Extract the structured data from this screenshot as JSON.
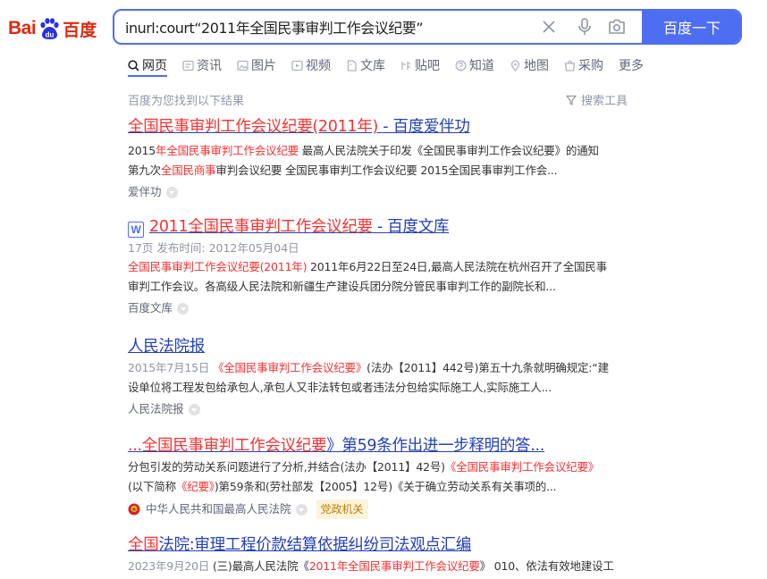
{
  "logo": {
    "latin": "Bai",
    "paw_text": "du",
    "chinese": "百度"
  },
  "search": {
    "query": "inurl:court“2011年全国民事审判工作会议纪要”",
    "button_label": "百度一下"
  },
  "tabs": [
    {
      "label": "网页",
      "icon": "search-icon",
      "active": true
    },
    {
      "label": "资讯",
      "icon": "news-icon"
    },
    {
      "label": "图片",
      "icon": "image-icon"
    },
    {
      "label": "视频",
      "icon": "video-icon"
    },
    {
      "label": "文库",
      "icon": "document-icon"
    },
    {
      "label": "贴吧",
      "icon": "tieba-icon"
    },
    {
      "label": "知道",
      "icon": "question-icon"
    },
    {
      "label": "地图",
      "icon": "map-icon"
    },
    {
      "label": "采购",
      "icon": "shopping-icon"
    },
    {
      "label": "更多"
    }
  ],
  "result_count": "百度为您找到以下结果",
  "tools_label": "搜索工具",
  "results": [
    {
      "title": {
        "a": "全国民事审判工作会议纪要(2011年)",
        "b": " - 百度爱伴功"
      },
      "abstract1": {
        "a": "2015",
        "b": "年全国民事审判工作会议纪要",
        "c": " 最高人民法院关于印发《全国民事审判工作会议纪要》的通知"
      },
      "abstract2": {
        "a": "第九次",
        "b": "全国民商事",
        "c": "审判会议纪要 全国民事审判工作会议纪要 2015全国民事审判工作会..."
      },
      "source": "爱伴功"
    },
    {
      "badge": "W",
      "title": {
        "a": "2011全国民事审判工作会议纪要",
        "b": " - 百度文库"
      },
      "meta": "17页 发布时间: 2012年05月04日",
      "abstract1": {
        "a": "全国民事审判工作会议纪要(2011年)",
        "b": " 2011年6月22日至24日,最高人民法院在杭州召开了全国民事"
      },
      "abstract2": "审判工作会议。各高级人民法院和新疆生产建设兵团分院分管民事审判工作的副院长和...",
      "source": "百度文库"
    },
    {
      "title": "人民法院报",
      "abstract1": {
        "a": "2015年7月15日 ",
        "b": "《全国民事审判工作会议纪要》",
        "c": "(法办【2011】442号)第五十九条就明确规定:“建"
      },
      "abstract2": "设单位将工程发包给承包人,承包人又非法转包或者违法分包给实际施工人,实际施工人...",
      "source": "人民法院报"
    },
    {
      "title": {
        "a": "...全国民事审判工作会议纪要",
        "b": "》第59条作出进一步释明的答..."
      },
      "abstract1": {
        "a": "分包引发的劳动关系问题进行了分析,并结合(法办【2011】42号)",
        "b": "《全国民事审判工作会议纪要》"
      },
      "abstract2": {
        "a": "(以下简称",
        "b": "《纪要》",
        "c": ")第59条和(劳社部发【2005】12号)《关于确立劳动关系有关事项的..."
      },
      "source": "中华人民共和国最高人民法院",
      "tag": "党政机关"
    },
    {
      "title": {
        "a": "全国",
        "b": "法院:审理工程价款结算依据纠纷司法观点汇编"
      },
      "abstract1": {
        "a": "2023年9月20日 ",
        "b": "(三)最高人民法院《",
        "c": "2011年全国民事审判工作会议纪要",
        "d": "》 010、依法有效地建设工"
      }
    }
  ]
}
